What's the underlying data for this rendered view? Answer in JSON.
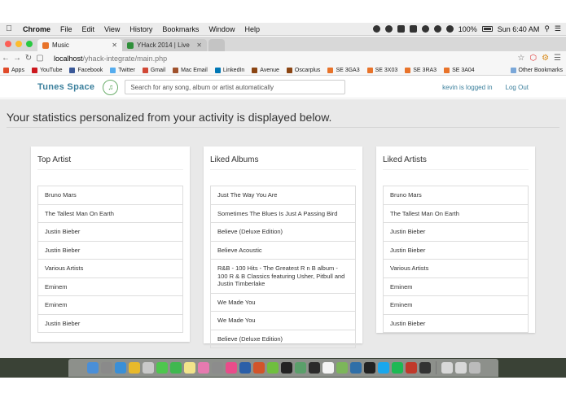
{
  "menubar": {
    "app_name": "Chrome",
    "items": [
      "File",
      "Edit",
      "View",
      "History",
      "Bookmarks",
      "Window",
      "Help"
    ],
    "battery": "100%",
    "clock": "Sun 6:40 AM"
  },
  "browser": {
    "tabs": [
      {
        "label": "Music",
        "active": true,
        "favicon_color": "#e8732a"
      },
      {
        "label": "YHack 2014 | Live",
        "active": false,
        "favicon_color": "#2f8f3a"
      }
    ],
    "url_host": "localhost",
    "url_path": "/yhack-integrate/main.php"
  },
  "bookmarks": {
    "items": [
      {
        "label": "Apps",
        "color": "#e04b2a"
      },
      {
        "label": "YouTube",
        "color": "#cc181e"
      },
      {
        "label": "Facebook",
        "color": "#3b5998"
      },
      {
        "label": "Twitter",
        "color": "#55acee"
      },
      {
        "label": "Gmail",
        "color": "#d14836"
      },
      {
        "label": "Mac Email",
        "color": "#a0522d"
      },
      {
        "label": "LinkedIn",
        "color": "#0077b5"
      },
      {
        "label": "Avenue",
        "color": "#8b4513"
      },
      {
        "label": "Oscarplus",
        "color": "#8b4513"
      },
      {
        "label": "SE 3GA3",
        "color": "#e8732a"
      },
      {
        "label": "SE 3X03",
        "color": "#e8732a"
      },
      {
        "label": "SE 3RA3",
        "color": "#e8732a"
      },
      {
        "label": "SE 3A04",
        "color": "#e8732a"
      }
    ],
    "other": "Other Bookmarks"
  },
  "app": {
    "brand": "Tunes Space",
    "search_placeholder": "Search for any song, album or artist automatically",
    "login_status": "kevin is logged in",
    "logout_label": "Log Out",
    "accent": "#3a7f9c"
  },
  "page": {
    "headline": "Your statistics personalized from your activity is displayed below."
  },
  "panels": {
    "top_artist": {
      "title": "Top Artist",
      "items": [
        "Bruno Mars",
        "The Tallest Man On Earth",
        "Justin Bieber",
        "Justin Bieber",
        "Various Artists",
        "Eminem",
        "Eminem",
        "Justin Bieber"
      ]
    },
    "liked_albums": {
      "title": "Liked Albums",
      "items": [
        "Just The Way You Are",
        "Sometimes The Blues Is Just A Passing Bird",
        "Believe (Deluxe Edition)",
        "Believe Acoustic",
        "R&B - 100 Hits - The Greatest R n B album - 100 R & B Classics featuring Usher, Pitbull and Justin Timberlake",
        "We Made You",
        "We Made You",
        "Believe (Deluxe Edition)"
      ]
    },
    "liked_artists": {
      "title": "Liked Artists",
      "items": [
        "Bruno Mars",
        "The Tallest Man On Earth",
        "Justin Bieber",
        "Justin Bieber",
        "Various Artists",
        "Eminem",
        "Eminem",
        "Justin Bieber"
      ]
    }
  },
  "dock": {
    "icons": [
      "finder-icon",
      "launchpad-icon",
      "safari-icon",
      "chrome-icon",
      "preview-icon",
      "messages-icon",
      "facetime-icon",
      "notes-icon",
      "photos-icon",
      "system-preferences-icon",
      "itunes-icon",
      "word-icon",
      "powerpoint-icon",
      "upwork-icon",
      "github-icon",
      "atom-icon",
      "terminal-icon",
      "calendar-icon",
      "android-studio-icon",
      "sourcetree-icon",
      "iterm-icon",
      "skype-icon",
      "spotify-icon",
      "filezilla-icon",
      "activity-monitor-icon",
      "documents-folder-icon",
      "downloads-folder-icon",
      "trash-icon"
    ],
    "colors": [
      "#4a8fd8",
      "#8a8a8a",
      "#3a8fd6",
      "#e8b92a",
      "#c9c9c9",
      "#4ec64e",
      "#3fb84f",
      "#f2e48a",
      "#e67ab0",
      "#8c8c8c",
      "#e94c8a",
      "#2b5fa8",
      "#d2542a",
      "#6fbf3f",
      "#222222",
      "#5a9f6a",
      "#2a2a2a",
      "#f4f4f4",
      "#7cb65a",
      "#2f6fa8",
      "#222222",
      "#1aa7ec",
      "#1db954",
      "#c0392b",
      "#333333",
      "#d8d8d8",
      "#d8d8d8",
      "#bbbbbb"
    ]
  }
}
